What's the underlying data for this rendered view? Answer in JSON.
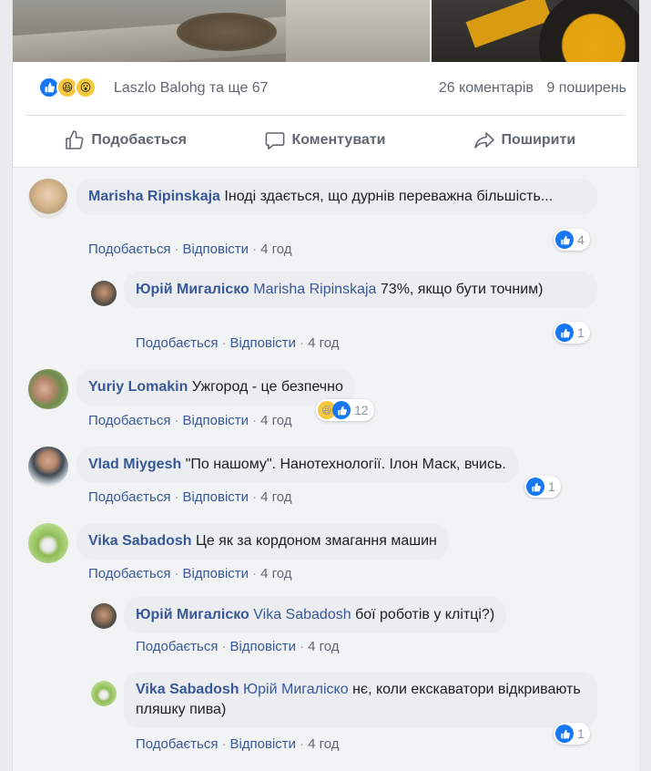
{
  "post": {
    "reactions_names": "Laszlo Balohg та ще 67",
    "comments_count": "26 коментарів",
    "shares_count": "9 поширень"
  },
  "actions": {
    "like": "Подобається",
    "comment": "Коментувати",
    "share": "Поширити"
  },
  "meta_labels": {
    "like": "Подобається",
    "reply": "Відповісти"
  },
  "comments": [
    {
      "author": "Marisha Ripinskaja",
      "text": "Іноді здається, що дурнів переважна більшість...",
      "time": "4 год",
      "reactions": "4"
    },
    {
      "author": "Юрій Мигаліско",
      "mention": "Marisha Ripinskaja",
      "text": "73%, якщо бути точним)",
      "time": "4 год",
      "reactions": "1"
    },
    {
      "author": "Yuriy Lomakin",
      "text": "Ужгород - це безпечно",
      "time": "4 год",
      "reactions": "12"
    },
    {
      "author": "Vlad Miygesh",
      "text": "\"По нашому\". Нанотехнології. Ілон Маск, вчись.",
      "time": "4 год",
      "reactions": "1"
    },
    {
      "author": "Vika Sabadosh",
      "text": "Це як за кордоном змагання машин",
      "time": "4 год"
    },
    {
      "author": "Юрій Мигаліско",
      "mention": "Vika Sabadosh",
      "text": "бої роботів у клітці?)",
      "time": "4 год"
    },
    {
      "author": "Vika Sabadosh",
      "mention": "Юрій Мигаліско",
      "text": "нє, коли екскаватори відкривають пляшку пива)",
      "time": "4 год",
      "reactions": "1"
    }
  ],
  "colors": {
    "link": "#385898",
    "like_blue": "#1877f2",
    "bubble": "#ebedf0",
    "muted": "#606770"
  }
}
